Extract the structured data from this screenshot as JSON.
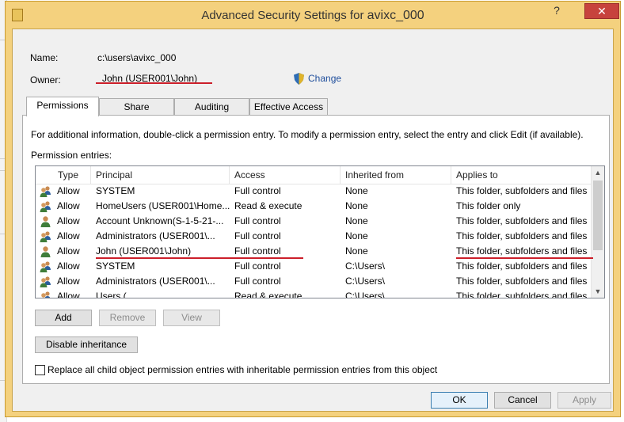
{
  "window": {
    "title_prefix": "Advanced Security Settings for",
    "title_object": "avixc_000",
    "help_label": "?",
    "close_label": "✕"
  },
  "name": {
    "label": "Name:",
    "value": "c:\\users\\avixc_000"
  },
  "owner": {
    "label": "Owner:",
    "value": "John (USER001\\John)",
    "change_label": "Change"
  },
  "tabs": [
    {
      "label": "Permissions",
      "active": true
    },
    {
      "label": "Share",
      "active": false
    },
    {
      "label": "Auditing",
      "active": false
    },
    {
      "label": "Effective Access",
      "active": false
    }
  ],
  "info_text": "For additional information, double-click a permission entry. To modify a permission entry, select the entry and click Edit (if available).",
  "entries_label": "Permission entries:",
  "columns": [
    "Type",
    "Principal",
    "Access",
    "Inherited from",
    "Applies to"
  ],
  "entries": [
    {
      "type": "Allow",
      "principal": "SYSTEM",
      "access": "Full control",
      "inherited": "None",
      "applies": "This folder, subfolders and files",
      "icon": "users-group-icon"
    },
    {
      "type": "Allow",
      "principal": "HomeUsers (USER001\\Home...",
      "access": "Read & execute",
      "inherited": "None",
      "applies": "This folder only",
      "icon": "users-group-icon"
    },
    {
      "type": "Allow",
      "principal": "Account Unknown(S-1-5-21-...",
      "access": "Full control",
      "inherited": "None",
      "applies": "This folder, subfolders and files",
      "icon": "user-icon"
    },
    {
      "type": "Allow",
      "principal": "Administrators (USER001\\...",
      "access": "Full control",
      "inherited": "None",
      "applies": "This folder, subfolders and files",
      "icon": "users-group-icon"
    },
    {
      "type": "Allow",
      "principal": "John (USER001\\John)",
      "access": "Full control",
      "inherited": "None",
      "applies": "This folder, subfolders and files",
      "icon": "user-icon"
    },
    {
      "type": "Allow",
      "principal": "SYSTEM",
      "access": "Full control",
      "inherited": "C:\\Users\\",
      "applies": "This folder, subfolders and files",
      "icon": "users-group-icon"
    },
    {
      "type": "Allow",
      "principal": "Administrators (USER001\\...",
      "access": "Full control",
      "inherited": "C:\\Users\\",
      "applies": "This folder, subfolders and files",
      "icon": "users-group-icon"
    },
    {
      "type": "Allow",
      "principal": "Users (...",
      "access": "Read & execute",
      "inherited": "C:\\Users\\",
      "applies": "This folder, subfolders and files",
      "icon": "users-group-icon"
    }
  ],
  "buttons": {
    "add": "Add",
    "remove": "Remove",
    "view": "View",
    "disable_inheritance": "Disable inheritance",
    "ok": "OK",
    "cancel": "Cancel",
    "apply": "Apply"
  },
  "replace_checkbox": {
    "label": "Replace all child object permission entries with inheritable permission entries from this object",
    "checked": false
  },
  "colors": {
    "frame": "#f4d17e",
    "annotation_red": "#cc1f2a",
    "link_blue": "#1f4e9c"
  }
}
